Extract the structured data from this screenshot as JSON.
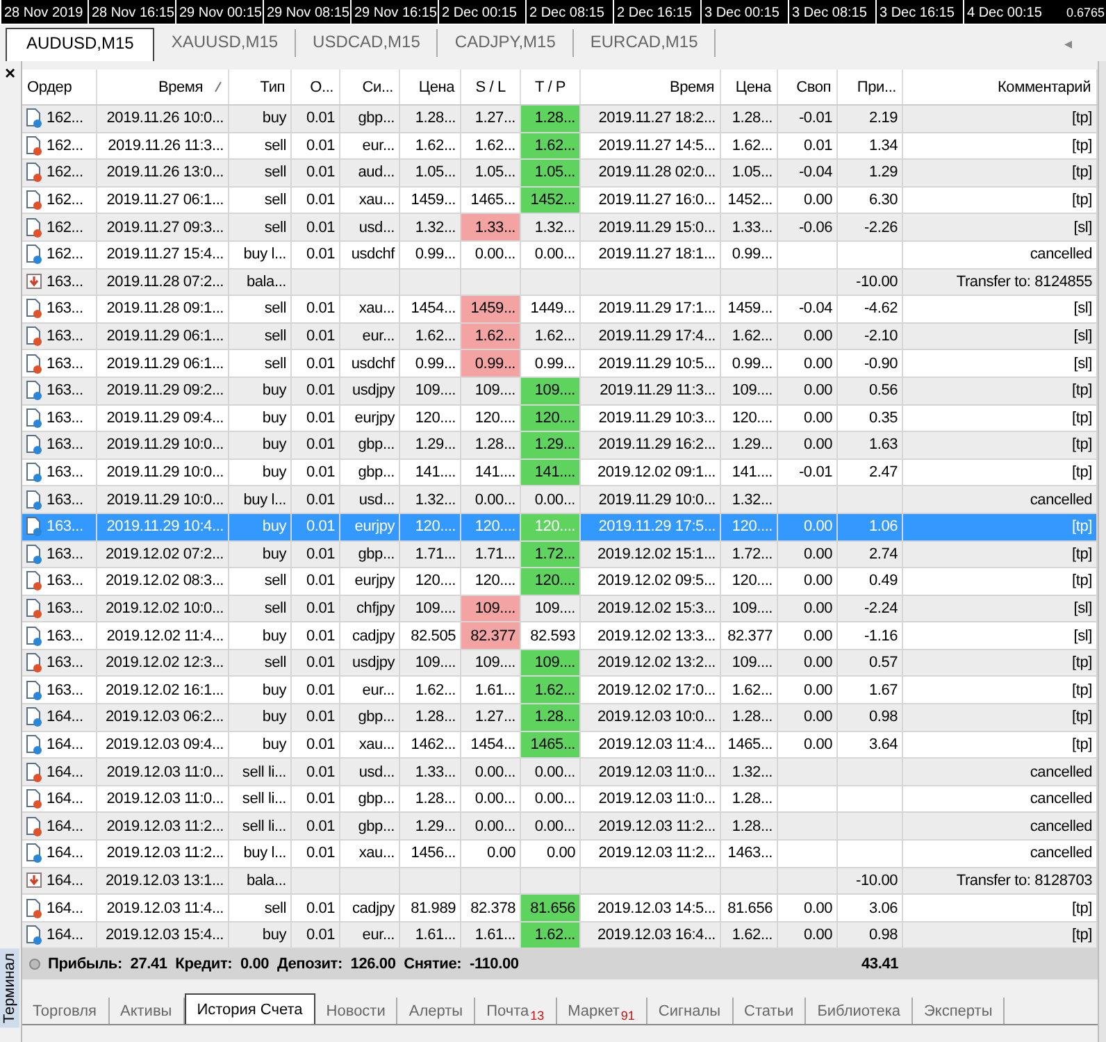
{
  "chart_axis": {
    "time_labels": [
      "28 Nov 2019",
      "28 Nov 16:15",
      "29 Nov 00:15",
      "29 Nov 08:15",
      "29 Nov 16:15",
      "2 Dec 00:15",
      "2 Dec 08:15",
      "2 Dec 16:15",
      "3 Dec 00:15",
      "3 Dec 08:15",
      "3 Dec 16:15",
      "4 Dec 00:15"
    ],
    "price_label": "0.6765"
  },
  "chart_tabs": [
    {
      "label": "AUDUSD,M15",
      "selected": true
    },
    {
      "label": "XAUUSD,M15",
      "selected": false
    },
    {
      "label": "USDCAD,M15",
      "selected": false
    },
    {
      "label": "CADJPY,M15",
      "selected": false
    },
    {
      "label": "EURCAD,M15",
      "selected": false
    }
  ],
  "chart_tabs_arrow": "◂",
  "terminal": {
    "title": "Терминал",
    "close": "×"
  },
  "table": {
    "columns": [
      {
        "label": "Ордер",
        "sorted": false
      },
      {
        "label": "Время",
        "sorted": true
      },
      {
        "label": "Тип",
        "sorted": false
      },
      {
        "label": "О...",
        "sorted": false
      },
      {
        "label": "Си...",
        "sorted": false
      },
      {
        "label": "Цена",
        "sorted": false
      },
      {
        "label": "S / L",
        "sorted": false
      },
      {
        "label": "T / P",
        "sorted": false
      },
      {
        "label": "Время",
        "sorted": false
      },
      {
        "label": "Цена",
        "sorted": false
      },
      {
        "label": "Своп",
        "sorted": false
      },
      {
        "label": "При...",
        "sorted": false
      },
      {
        "label": "Комментарий",
        "sorted": false
      }
    ],
    "rows": [
      {
        "kind": "buy",
        "selected": false,
        "sl_hit": false,
        "tp_hit": true,
        "order": "162...",
        "time": "2019.11.26 10:0...",
        "type": "buy",
        "volume": "0.01",
        "symbol": "gbp...",
        "price": "1.28...",
        "sl": "1.27...",
        "tp": "1.28...",
        "close_time": "2019.11.27 18:2...",
        "close_price": "1.28...",
        "swap": "-0.01",
        "profit": "2.19",
        "comment": "[tp]"
      },
      {
        "kind": "sell",
        "selected": false,
        "sl_hit": false,
        "tp_hit": true,
        "order": "162...",
        "time": "2019.11.26 11:3...",
        "type": "sell",
        "volume": "0.01",
        "symbol": "eur...",
        "price": "1.62...",
        "sl": "1.62...",
        "tp": "1.62...",
        "close_time": "2019.11.27 14:5...",
        "close_price": "1.62...",
        "swap": "0.01",
        "profit": "1.34",
        "comment": "[tp]"
      },
      {
        "kind": "sell",
        "selected": false,
        "sl_hit": false,
        "tp_hit": true,
        "order": "162...",
        "time": "2019.11.26 13:0...",
        "type": "sell",
        "volume": "0.01",
        "symbol": "aud...",
        "price": "1.05...",
        "sl": "1.05...",
        "tp": "1.05...",
        "close_time": "2019.11.28 02:0...",
        "close_price": "1.05...",
        "swap": "-0.04",
        "profit": "1.29",
        "comment": "[tp]"
      },
      {
        "kind": "sell",
        "selected": false,
        "sl_hit": false,
        "tp_hit": true,
        "order": "162...",
        "time": "2019.11.27 06:1...",
        "type": "sell",
        "volume": "0.01",
        "symbol": "xau...",
        "price": "1459...",
        "sl": "1465...",
        "tp": "1452...",
        "close_time": "2019.11.27 16:0...",
        "close_price": "1452...",
        "swap": "0.00",
        "profit": "6.30",
        "comment": "[tp]"
      },
      {
        "kind": "sell",
        "selected": false,
        "sl_hit": true,
        "tp_hit": false,
        "order": "162...",
        "time": "2019.11.27 09:3...",
        "type": "sell",
        "volume": "0.01",
        "symbol": "usd...",
        "price": "1.32...",
        "sl": "1.33...",
        "tp": "1.32...",
        "close_time": "2019.11.29 15:0...",
        "close_price": "1.33...",
        "swap": "-0.06",
        "profit": "-2.26",
        "comment": "[sl]"
      },
      {
        "kind": "buy",
        "selected": false,
        "sl_hit": false,
        "tp_hit": false,
        "order": "162...",
        "time": "2019.11.27 15:4...",
        "type": "buy l...",
        "volume": "0.01",
        "symbol": "usdchf",
        "price": "0.99...",
        "sl": "0.00...",
        "tp": "0.00...",
        "close_time": "2019.11.27 18:1...",
        "close_price": "0.99...",
        "comment": "cancelled"
      },
      {
        "kind": "balance",
        "selected": false,
        "order": "163...",
        "time": "2019.11.28 07:2...",
        "type": "bala...",
        "profit": "-10.00",
        "comment": "Transfer to: 8124855"
      },
      {
        "kind": "sell",
        "selected": false,
        "sl_hit": true,
        "tp_hit": false,
        "order": "163...",
        "time": "2019.11.28 09:1...",
        "type": "sell",
        "volume": "0.01",
        "symbol": "xau...",
        "price": "1454...",
        "sl": "1459...",
        "tp": "1449...",
        "close_time": "2019.11.29 17:1...",
        "close_price": "1459...",
        "swap": "-0.04",
        "profit": "-4.62",
        "comment": "[sl]"
      },
      {
        "kind": "sell",
        "selected": false,
        "sl_hit": true,
        "tp_hit": false,
        "order": "163...",
        "time": "2019.11.29 06:1...",
        "type": "sell",
        "volume": "0.01",
        "symbol": "eur...",
        "price": "1.62...",
        "sl": "1.62...",
        "tp": "1.62...",
        "close_time": "2019.11.29 17:4...",
        "close_price": "1.62...",
        "swap": "0.00",
        "profit": "-2.10",
        "comment": "[sl]"
      },
      {
        "kind": "sell",
        "selected": false,
        "sl_hit": true,
        "tp_hit": false,
        "order": "163...",
        "time": "2019.11.29 06:1...",
        "type": "sell",
        "volume": "0.01",
        "symbol": "usdchf",
        "price": "0.99...",
        "sl": "0.99...",
        "tp": "0.99...",
        "close_time": "2019.11.29 10:5...",
        "close_price": "0.99...",
        "swap": "0.00",
        "profit": "-0.90",
        "comment": "[sl]"
      },
      {
        "kind": "buy",
        "selected": false,
        "sl_hit": false,
        "tp_hit": true,
        "order": "163...",
        "time": "2019.11.29 09:2...",
        "type": "buy",
        "volume": "0.01",
        "symbol": "usdjpy",
        "price": "109....",
        "sl": "109....",
        "tp": "109....",
        "close_time": "2019.11.29 11:3...",
        "close_price": "109....",
        "swap": "0.00",
        "profit": "0.56",
        "comment": "[tp]"
      },
      {
        "kind": "buy",
        "selected": false,
        "sl_hit": false,
        "tp_hit": true,
        "order": "163...",
        "time": "2019.11.29 09:4...",
        "type": "buy",
        "volume": "0.01",
        "symbol": "eurjpy",
        "price": "120....",
        "sl": "120....",
        "tp": "120....",
        "close_time": "2019.11.29 10:3...",
        "close_price": "120....",
        "swap": "0.00",
        "profit": "0.35",
        "comment": "[tp]"
      },
      {
        "kind": "buy",
        "selected": false,
        "sl_hit": false,
        "tp_hit": true,
        "order": "163...",
        "time": "2019.11.29 10:0...",
        "type": "buy",
        "volume": "0.01",
        "symbol": "gbp...",
        "price": "1.29...",
        "sl": "1.28...",
        "tp": "1.29...",
        "close_time": "2019.11.29 16:2...",
        "close_price": "1.29...",
        "swap": "0.00",
        "profit": "1.63",
        "comment": "[tp]"
      },
      {
        "kind": "buy",
        "selected": false,
        "sl_hit": false,
        "tp_hit": true,
        "order": "163...",
        "time": "2019.11.29 10:0...",
        "type": "buy",
        "volume": "0.01",
        "symbol": "gbp...",
        "price": "141....",
        "sl": "141....",
        "tp": "141....",
        "close_time": "2019.12.02 09:1...",
        "close_price": "141....",
        "swap": "-0.01",
        "profit": "2.47",
        "comment": "[tp]"
      },
      {
        "kind": "buy",
        "selected": false,
        "sl_hit": false,
        "tp_hit": false,
        "order": "163...",
        "time": "2019.11.29 10:0...",
        "type": "buy l...",
        "volume": "0.01",
        "symbol": "usd...",
        "price": "1.32...",
        "sl": "0.00...",
        "tp": "0.00...",
        "close_time": "2019.11.29 10:0...",
        "close_price": "1.32...",
        "comment": "cancelled"
      },
      {
        "kind": "buy",
        "selected": true,
        "sl_hit": false,
        "tp_hit": true,
        "order": "163...",
        "time": "2019.11.29 10:4...",
        "type": "buy",
        "volume": "0.01",
        "symbol": "eurjpy",
        "price": "120....",
        "sl": "120....",
        "tp": "120....",
        "close_time": "2019.11.29 17:5...",
        "close_price": "120....",
        "swap": "0.00",
        "profit": "1.06",
        "comment": "[tp]"
      },
      {
        "kind": "buy",
        "selected": false,
        "sl_hit": false,
        "tp_hit": true,
        "order": "163...",
        "time": "2019.12.02 07:2...",
        "type": "buy",
        "volume": "0.01",
        "symbol": "gbp...",
        "price": "1.71...",
        "sl": "1.71...",
        "tp": "1.72...",
        "close_time": "2019.12.02 15:1...",
        "close_price": "1.72...",
        "swap": "0.00",
        "profit": "2.74",
        "comment": "[tp]"
      },
      {
        "kind": "sell",
        "selected": false,
        "sl_hit": false,
        "tp_hit": true,
        "order": "163...",
        "time": "2019.12.02 08:3...",
        "type": "sell",
        "volume": "0.01",
        "symbol": "eurjpy",
        "price": "120....",
        "sl": "120....",
        "tp": "120....",
        "close_time": "2019.12.02 09:5...",
        "close_price": "120....",
        "swap": "0.00",
        "profit": "0.49",
        "comment": "[tp]"
      },
      {
        "kind": "sell",
        "selected": false,
        "sl_hit": true,
        "tp_hit": false,
        "order": "163...",
        "time": "2019.12.02 10:0...",
        "type": "sell",
        "volume": "0.01",
        "symbol": "chfjpy",
        "price": "109....",
        "sl": "109....",
        "tp": "109....",
        "close_time": "2019.12.02 15:3...",
        "close_price": "109....",
        "swap": "0.00",
        "profit": "-2.24",
        "comment": "[sl]"
      },
      {
        "kind": "buy",
        "selected": false,
        "sl_hit": true,
        "tp_hit": false,
        "order": "163...",
        "time": "2019.12.02 11:4...",
        "type": "buy",
        "volume": "0.01",
        "symbol": "cadjpy",
        "price": "82.505",
        "sl": "82.377",
        "tp": "82.593",
        "close_time": "2019.12.02 13:3...",
        "close_price": "82.377",
        "swap": "0.00",
        "profit": "-1.16",
        "comment": "[sl]"
      },
      {
        "kind": "sell",
        "selected": false,
        "sl_hit": false,
        "tp_hit": true,
        "order": "163...",
        "time": "2019.12.02 12:3...",
        "type": "sell",
        "volume": "0.01",
        "symbol": "usdjpy",
        "price": "109....",
        "sl": "109....",
        "tp": "109....",
        "close_time": "2019.12.02 13:2...",
        "close_price": "109....",
        "swap": "0.00",
        "profit": "0.57",
        "comment": "[tp]"
      },
      {
        "kind": "buy",
        "selected": false,
        "sl_hit": false,
        "tp_hit": true,
        "order": "163...",
        "time": "2019.12.02 16:1...",
        "type": "buy",
        "volume": "0.01",
        "symbol": "eur...",
        "price": "1.62...",
        "sl": "1.61...",
        "tp": "1.62...",
        "close_time": "2019.12.02 17:0...",
        "close_price": "1.62...",
        "swap": "0.00",
        "profit": "1.67",
        "comment": "[tp]"
      },
      {
        "kind": "buy",
        "selected": false,
        "sl_hit": false,
        "tp_hit": true,
        "order": "164...",
        "time": "2019.12.03 06:2...",
        "type": "buy",
        "volume": "0.01",
        "symbol": "gbp...",
        "price": "1.28...",
        "sl": "1.27...",
        "tp": "1.28...",
        "close_time": "2019.12.03 10:0...",
        "close_price": "1.28...",
        "swap": "0.00",
        "profit": "0.98",
        "comment": "[tp]"
      },
      {
        "kind": "buy",
        "selected": false,
        "sl_hit": false,
        "tp_hit": true,
        "order": "164...",
        "time": "2019.12.03 09:4...",
        "type": "buy",
        "volume": "0.01",
        "symbol": "xau...",
        "price": "1462...",
        "sl": "1454...",
        "tp": "1465...",
        "close_time": "2019.12.03 11:4...",
        "close_price": "1465...",
        "swap": "0.00",
        "profit": "3.64",
        "comment": "[tp]"
      },
      {
        "kind": "sell",
        "selected": false,
        "sl_hit": false,
        "tp_hit": false,
        "order": "164...",
        "time": "2019.12.03 11:0...",
        "type": "sell li...",
        "volume": "0.01",
        "symbol": "usd...",
        "price": "1.33...",
        "sl": "0.00...",
        "tp": "0.00...",
        "close_time": "2019.12.03 11:0...",
        "close_price": "1.32...",
        "comment": "cancelled"
      },
      {
        "kind": "sell",
        "selected": false,
        "sl_hit": false,
        "tp_hit": false,
        "order": "164...",
        "time": "2019.12.03 11:0...",
        "type": "sell li...",
        "volume": "0.01",
        "symbol": "gbp...",
        "price": "1.28...",
        "sl": "0.00...",
        "tp": "0.00...",
        "close_time": "2019.12.03 11:0...",
        "close_price": "1.28...",
        "comment": "cancelled"
      },
      {
        "kind": "sell",
        "selected": false,
        "sl_hit": false,
        "tp_hit": false,
        "order": "164...",
        "time": "2019.12.03 11:2...",
        "type": "sell li...",
        "volume": "0.01",
        "symbol": "gbp...",
        "price": "1.29...",
        "sl": "0.00...",
        "tp": "0.00...",
        "close_time": "2019.12.03 11:2...",
        "close_price": "1.28...",
        "comment": "cancelled"
      },
      {
        "kind": "buy",
        "selected": false,
        "sl_hit": false,
        "tp_hit": false,
        "order": "164...",
        "time": "2019.12.03 11:2...",
        "type": "buy l...",
        "volume": "0.01",
        "symbol": "xau...",
        "price": "1456...",
        "sl": "0.00",
        "tp": "0.00",
        "close_time": "2019.12.03 11:2...",
        "close_price": "1463...",
        "comment": "cancelled"
      },
      {
        "kind": "balance",
        "selected": false,
        "order": "164...",
        "time": "2019.12.03 13:1...",
        "type": "bala...",
        "profit": "-10.00",
        "comment": "Transfer to: 8128703"
      },
      {
        "kind": "sell",
        "selected": false,
        "sl_hit": false,
        "tp_hit": true,
        "order": "164...",
        "time": "2019.12.03 11:4...",
        "type": "sell",
        "volume": "0.01",
        "symbol": "cadjpy",
        "price": "81.989",
        "sl": "82.378",
        "tp": "81.656",
        "close_time": "2019.12.03 14:5...",
        "close_price": "81.656",
        "swap": "0.00",
        "profit": "3.06",
        "comment": "[tp]"
      },
      {
        "kind": "buy",
        "selected": false,
        "sl_hit": false,
        "tp_hit": true,
        "order": "164...",
        "time": "2019.12.03 15:4...",
        "type": "buy",
        "volume": "0.01",
        "symbol": "eur...",
        "price": "1.61...",
        "sl": "1.61...",
        "tp": "1.62...",
        "close_time": "2019.12.03 16:4...",
        "close_price": "1.62...",
        "swap": "0.00",
        "profit": "0.98",
        "comment": "[tp]"
      }
    ],
    "summary": {
      "text": "Прибыль: 27.41  Кредит: 0.00  Депозит: 126.00  Снятие: -110.00",
      "profit": "43.41"
    }
  },
  "bottom_tabs": [
    {
      "label": "Торговля",
      "selected": false
    },
    {
      "label": "Активы",
      "selected": false
    },
    {
      "label": "История Счета",
      "selected": true
    },
    {
      "label": "Новости",
      "selected": false
    },
    {
      "label": "Алерты",
      "selected": false
    },
    {
      "label": "Почта",
      "selected": false,
      "badge": "13"
    },
    {
      "label": "Маркет",
      "selected": false,
      "badge": "91"
    },
    {
      "label": "Сигналы",
      "selected": false
    },
    {
      "label": "Статьи",
      "selected": false
    },
    {
      "label": "Библиотека",
      "selected": false
    },
    {
      "label": "Эксперты",
      "selected": false
    }
  ]
}
